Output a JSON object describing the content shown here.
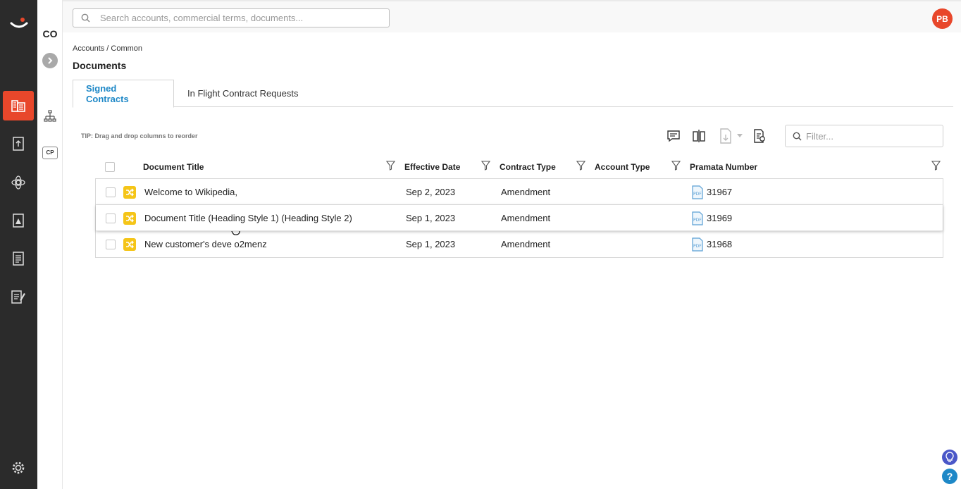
{
  "app": {
    "colors": {
      "accent": "#e8472b",
      "link": "#1e88c7",
      "rail": "#2b2b2b",
      "badge": "#f5c518"
    }
  },
  "subrail": {
    "account_code": "CO",
    "cp_label": "CP"
  },
  "header": {
    "search_placeholder": "Search accounts, commercial terms, documents...",
    "avatar_initials": "PB"
  },
  "breadcrumb": "Accounts / Common",
  "page_title": "Documents",
  "tabs": [
    {
      "label": "Signed Contracts",
      "active": true
    },
    {
      "label": "In Flight Contract Requests",
      "active": false
    }
  ],
  "tip": "TIP: Drag and drop columns to reorder",
  "filter_placeholder": "Filter...",
  "columns": [
    "Document Title",
    "Effective Date",
    "Contract Type",
    "Account Type",
    "Pramata Number"
  ],
  "rows": [
    {
      "title": "Welcome to Wikipedia,",
      "effective_date": "Sep 2, 2023",
      "contract_type": "Amendment",
      "account_type": "",
      "pramata_number": "31967"
    },
    {
      "title": "Document Title (Heading Style 1) (Heading Style 2)",
      "effective_date": "Sep 1, 2023",
      "contract_type": "Amendment",
      "account_type": "",
      "pramata_number": "31969"
    },
    {
      "title": "New customer's deve o2menz",
      "effective_date": "Sep 1, 2023",
      "contract_type": "Amendment",
      "account_type": "",
      "pramata_number": "31968"
    }
  ],
  "help": {
    "question_mark": "?"
  }
}
